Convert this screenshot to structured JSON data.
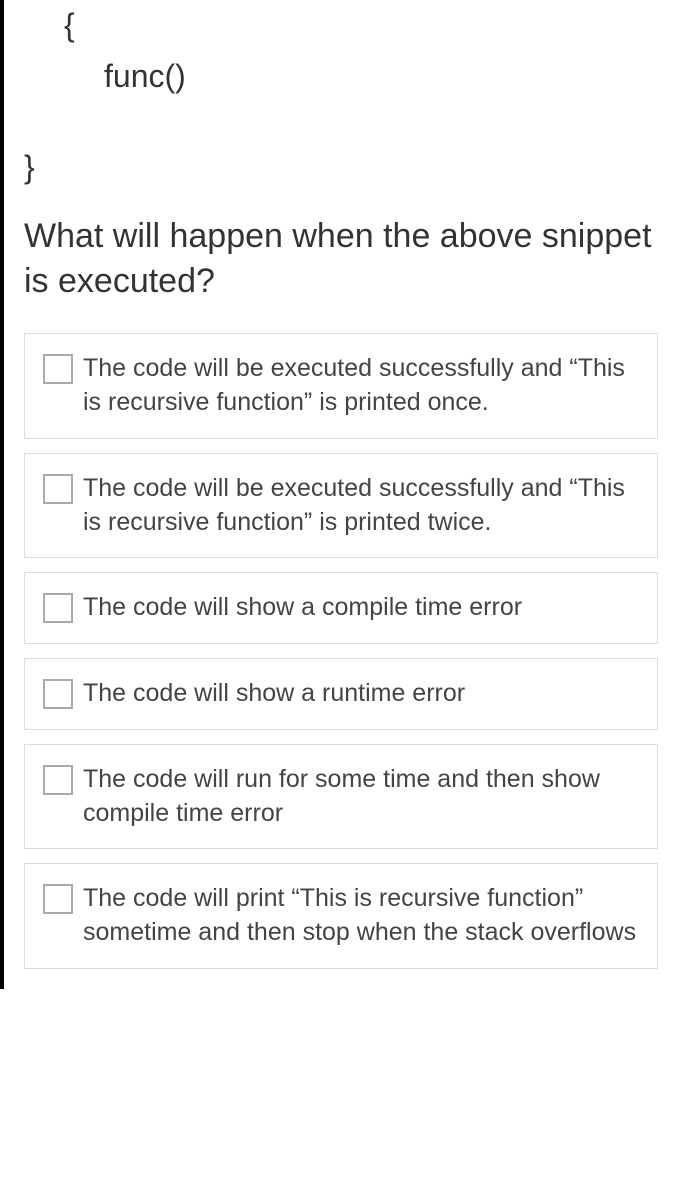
{
  "code": {
    "line1": "{",
    "line2": "func()",
    "line3": "}"
  },
  "question": "What will happen when the above snippet is executed?",
  "options": [
    {
      "text": "The code will be executed successfully and “This is recursive function” is printed once."
    },
    {
      "text": "The code will be executed successfully and “This is recursive function” is printed twice."
    },
    {
      "text": "The code will show a compile time error"
    },
    {
      "text": "The code will show a runtime error"
    },
    {
      "text": "The code will run for some time and then show compile time error"
    },
    {
      "text": "The code will print “This is recursive function” sometime and then stop when the stack overflows"
    }
  ]
}
